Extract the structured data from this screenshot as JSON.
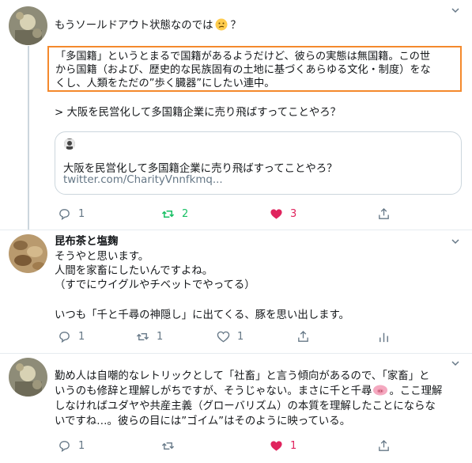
{
  "tweets": [
    {
      "text": "もうソールドアウト状態なのでは",
      "text_suffix": "？",
      "emoji": "confused-face-emoji",
      "quote_lines": [
        "「多国籍」というとまるで国籍があるようだけど、彼らの実態は無国籍。この世",
        "から国籍（および、歴史的な民族固有の土地に基づくあらゆる文化・制度）をな",
        "くし、人類をただの”歩く臓器”にしたい連中。"
      ],
      "reply_text": "> 大阪を民営化して多国籍企業に売り飛ばすってことやろ？",
      "card": {
        "title": "大阪を民営化して多国籍企業に売り飛ばすってことやろ？",
        "url": "twitter.com/CharityVnnfkmq..."
      },
      "actions": {
        "reply": "1",
        "retweet": "2",
        "like": "3"
      }
    },
    {
      "author": "昆布茶と塩麹",
      "lines": [
        "そうやと思います。",
        "人間を家畜にしたいんですよね。",
        "（すでにウイグルやチベットでやってる）",
        "",
        "いつも「千と千尋の神隠し」に出てくる、豚を思い出します。"
      ],
      "actions": {
        "reply": "1",
        "retweet": "1",
        "like": "1"
      }
    },
    {
      "lines": [
        "勤め人は自嘲的なレトリックとして「社畜」と言う傾向があるので、「家畜」と",
        "いうのも修辞と理解しがちですが、そうじゃない。まさに千と千尋",
        "しなければユダヤや共産主義（グローバリズム）の本質を理解したことにならな",
        "いですね…。彼らの目には”ゴイム”はそのように映っている。"
      ],
      "line2_suffix": "。ここ理解",
      "emoji": "pig-face-emoji",
      "actions": {
        "reply": "1",
        "retweet": "",
        "like": "1"
      }
    }
  ],
  "icons": {
    "reply": "speech-bubble-icon",
    "retweet": "retweet-icon",
    "like": "heart-icon",
    "share": "share-icon",
    "analytics": "bar-chart-icon",
    "more": "chevron-down-icon"
  },
  "colors": {
    "retweet_active": "#17bf63",
    "like_active": "#e0245e",
    "icon_gray": "#657786",
    "highlight_border": "#f4892c"
  }
}
